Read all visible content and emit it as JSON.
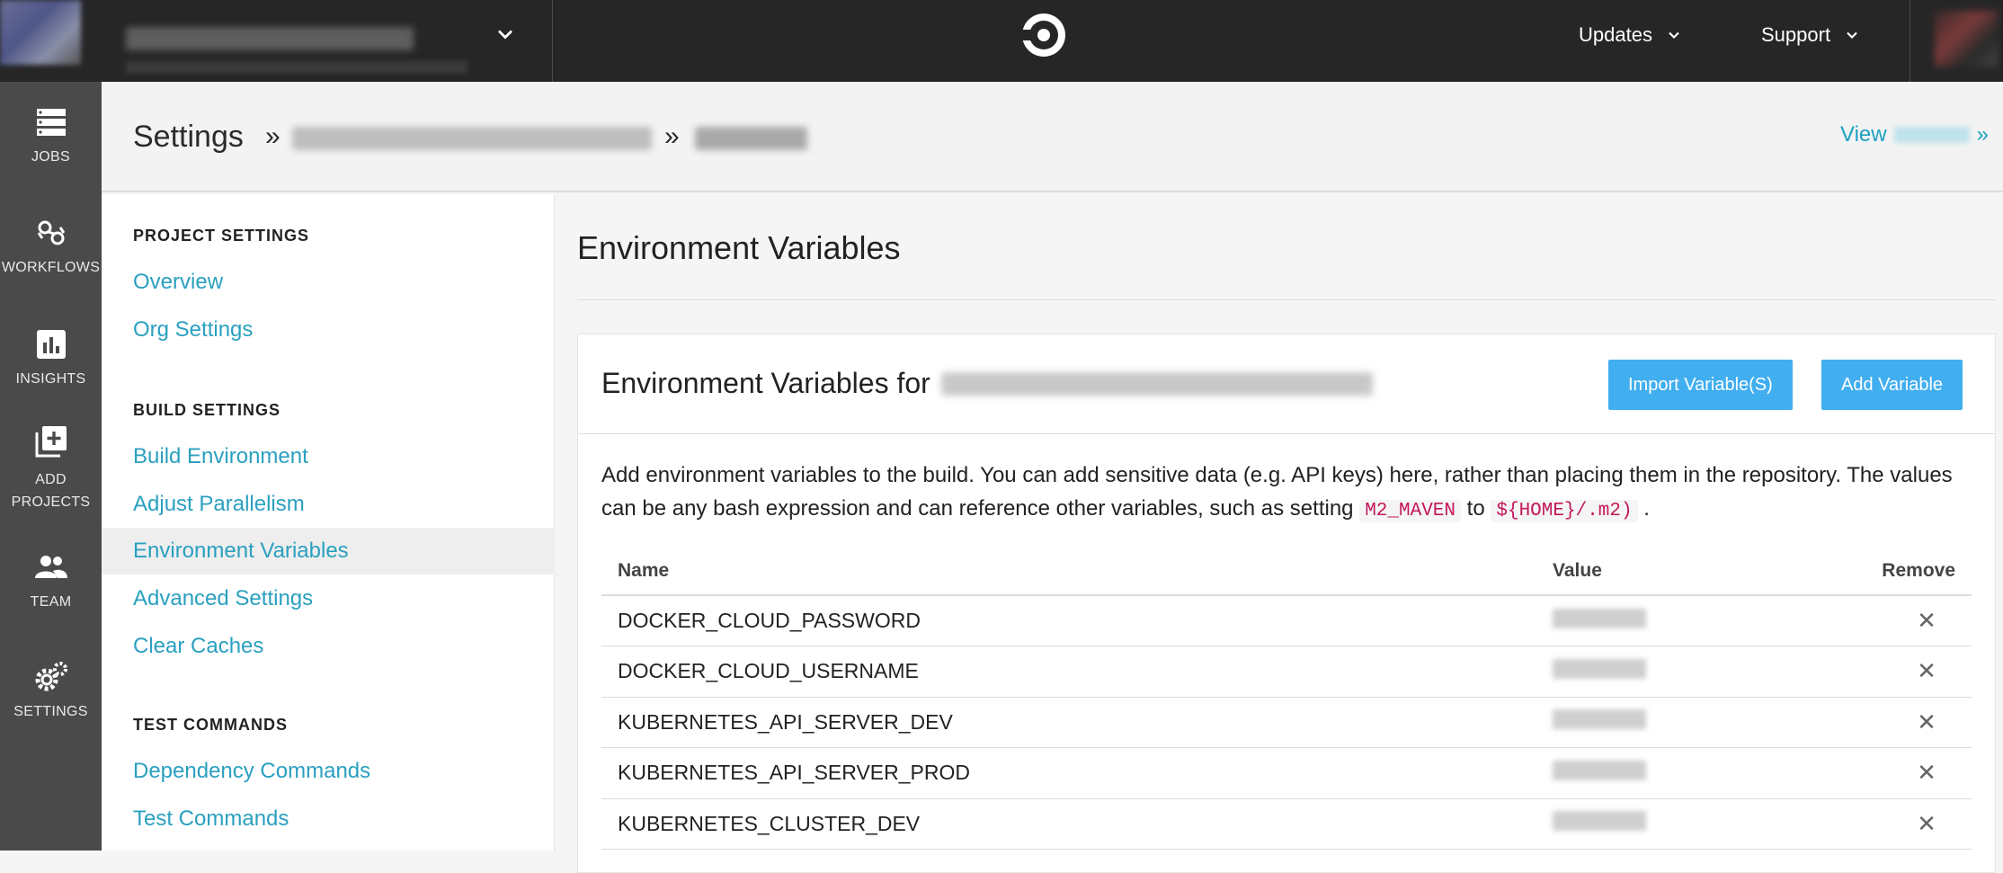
{
  "topbar": {
    "updates_label": "Updates",
    "support_label": "Support"
  },
  "leftnav": {
    "items": [
      {
        "label": "JOBS",
        "icon": "jobs-icon"
      },
      {
        "label": "WORKFLOWS",
        "icon": "workflows-icon"
      },
      {
        "label": "INSIGHTS",
        "icon": "insights-icon"
      },
      {
        "label_line1": "ADD",
        "label_line2": "PROJECTS",
        "icon": "add-projects-icon"
      },
      {
        "label": "TEAM",
        "icon": "team-icon"
      },
      {
        "label": "SETTINGS",
        "icon": "settings-icon"
      }
    ]
  },
  "header": {
    "title": "Settings",
    "sep": "»",
    "view_label": "View",
    "view_suffix": "»"
  },
  "sidemenu": {
    "project_settings": "PROJECT SETTINGS",
    "overview": "Overview",
    "org_settings": "Org Settings",
    "build_settings": "BUILD SETTINGS",
    "build_environment": "Build Environment",
    "adjust_parallelism": "Adjust Parallelism",
    "environment_variables": "Environment Variables",
    "advanced_settings": "Advanced Settings",
    "clear_caches": "Clear Caches",
    "test_commands_h": "TEST COMMANDS",
    "dependency_commands": "Dependency Commands",
    "test_commands": "Test Commands"
  },
  "main": {
    "title": "Environment Variables",
    "card_title": "Environment Variables for",
    "import_button": "Import Variable(S)",
    "add_button": "Add Variable",
    "desc_part1": "Add environment variables to the build. You can add sensitive data (e.g. API keys) here, rather than placing them in the repository. The values can be any bash expression and can reference other variables, such as setting ",
    "code1": "M2_MAVEN",
    "desc_part2": " to ",
    "code2": "${HOME}/.m2)",
    "desc_part3": " .",
    "table": {
      "col_name": "Name",
      "col_value": "Value",
      "col_remove": "Remove",
      "rows": [
        {
          "name": "DOCKER_CLOUD_PASSWORD"
        },
        {
          "name": "DOCKER_CLOUD_USERNAME"
        },
        {
          "name": "KUBERNETES_API_SERVER_DEV"
        },
        {
          "name": "KUBERNETES_API_SERVER_PROD"
        },
        {
          "name": "KUBERNETES_CLUSTER_DEV"
        }
      ]
    }
  },
  "colors": {
    "topbar": "#262626",
    "leftnav": "#4a4a4a",
    "link": "#2aa0c0",
    "button": "#41aef0",
    "code": "#c2185b"
  }
}
